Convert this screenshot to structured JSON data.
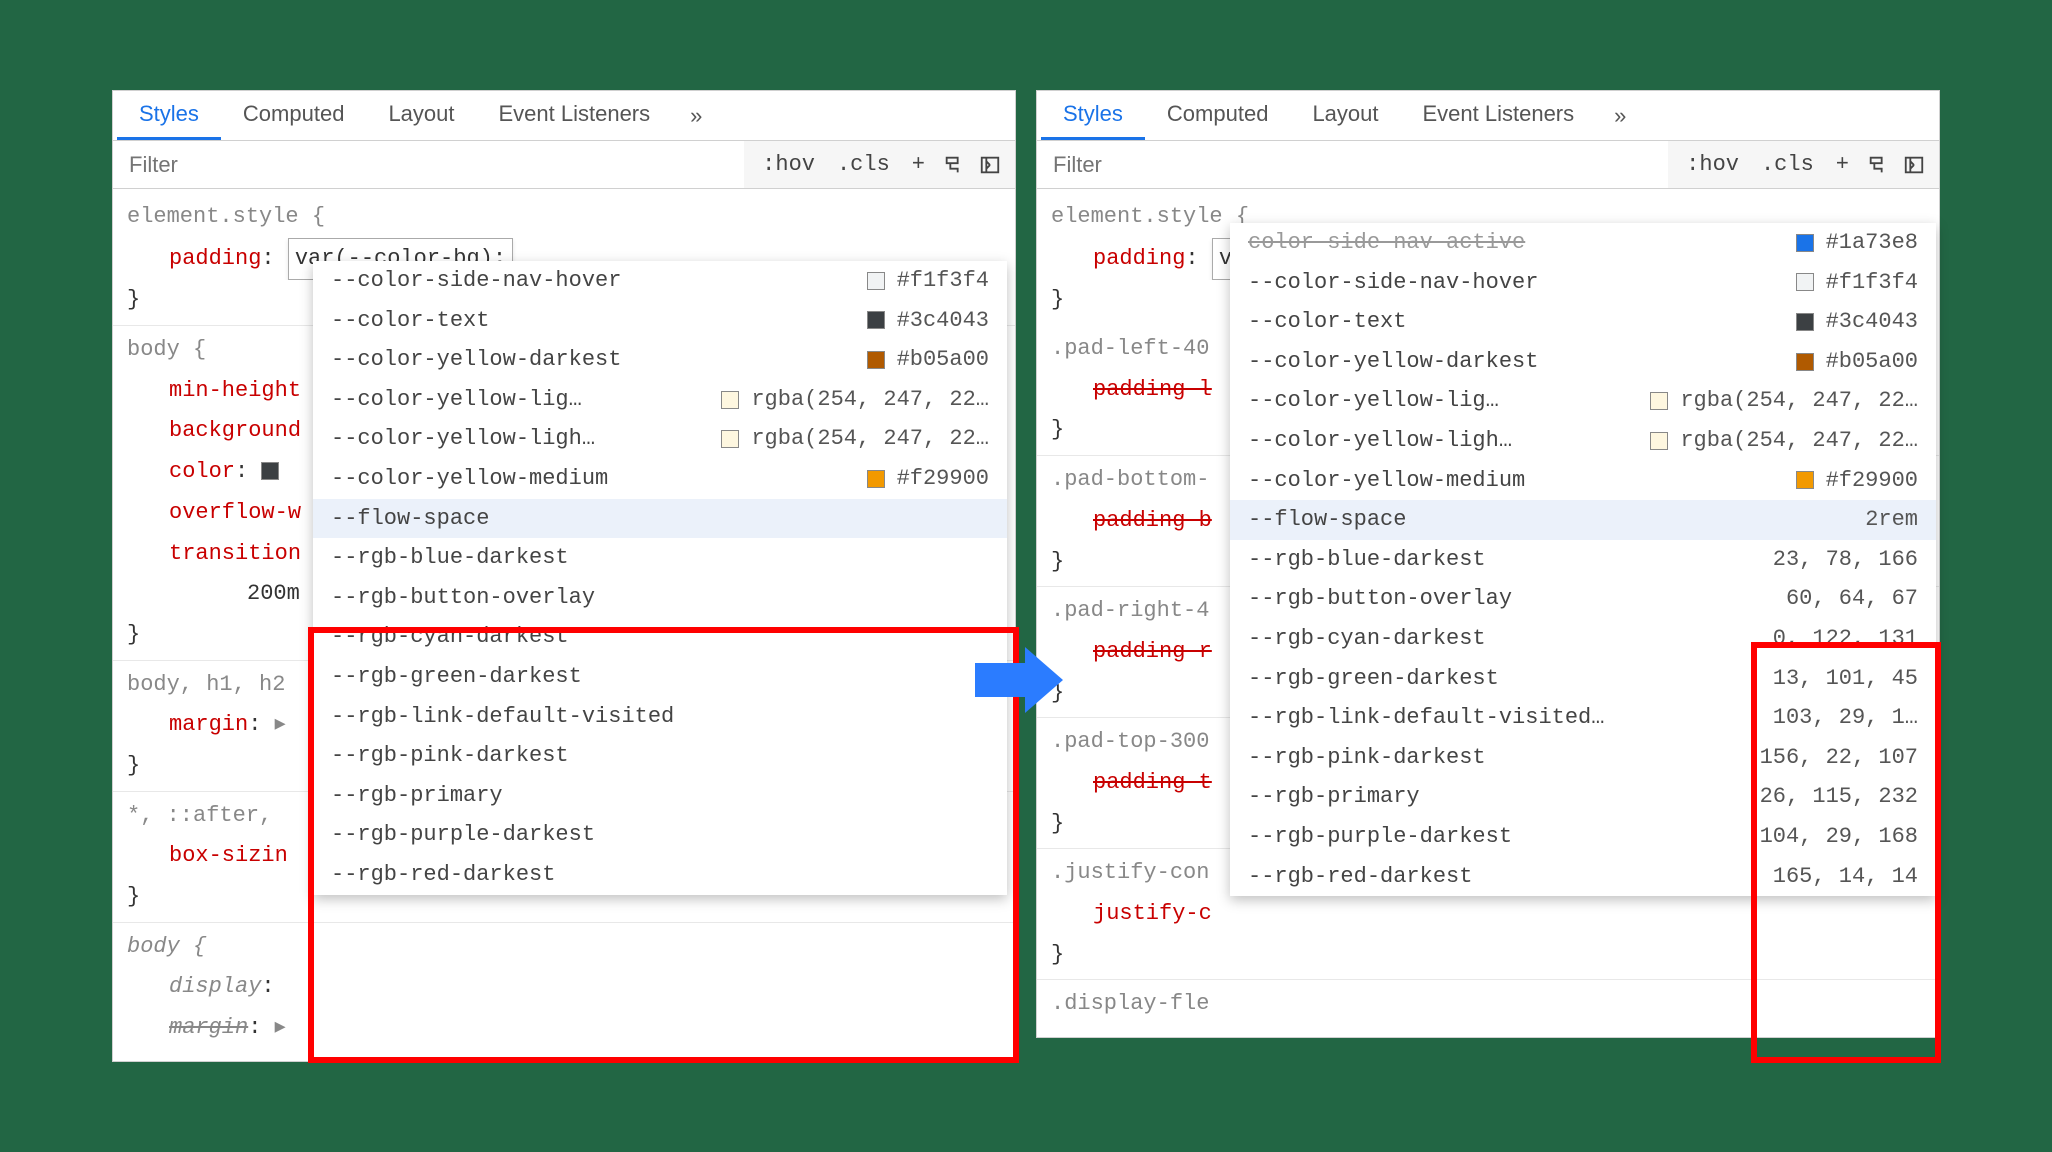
{
  "tabs": [
    "Styles",
    "Computed",
    "Layout",
    "Event Listeners"
  ],
  "active_tab": 0,
  "filter_placeholder": "Filter",
  "toolbar": {
    "hov": ":hov",
    "cls": ".cls",
    "plus": "+"
  },
  "element_style_text": "element.style {",
  "padding_prop": "padding",
  "padding_val": "var(--color-bg);",
  "close_brace": "}",
  "left_rules": [
    {
      "selector": "body {",
      "props": [
        {
          "name": "min-height",
          "partial": true
        },
        {
          "name": "background",
          "partial": true
        },
        {
          "name": "color",
          "val_prefix": "■",
          "partial": true
        },
        {
          "name": "overflow-w",
          "partial": true
        },
        {
          "name": "transition",
          "partial": true
        },
        {
          "indent": "200m",
          "partial": true
        }
      ]
    },
    {
      "selector": "body, h1, h2",
      "props": [
        {
          "name": "margin",
          "val_prefix": "▸"
        }
      ]
    },
    {
      "selector": "*, ::after,",
      "props": [
        {
          "name": "box-sizin",
          "partial": true
        }
      ]
    },
    {
      "selector_italic": "body {",
      "props": [
        {
          "name": "display",
          "italic": true
        },
        {
          "name": "margin",
          "val_prefix": "▸",
          "italic": true,
          "strike": true
        }
      ]
    }
  ],
  "right_rules": [
    {
      "selector": ".pad-left-40",
      "props": [
        {
          "name": "padding-l",
          "strike": true
        }
      ]
    },
    {
      "selector": ".pad-bottom-",
      "props": [
        {
          "name": "padding-b",
          "strike": true
        }
      ]
    },
    {
      "selector": ".pad-right-4",
      "props": [
        {
          "name": "padding-r",
          "strike": true
        }
      ]
    },
    {
      "selector": ".pad-top-300",
      "props": [
        {
          "name": "padding-t",
          "strike": true
        }
      ]
    },
    {
      "selector": ".justify-con",
      "props": [
        {
          "name": "justify-c"
        }
      ]
    },
    {
      "selector": ".display-fle"
    }
  ],
  "autocomplete_top": [
    {
      "name": "--color-side-nav-hover",
      "swatch": "#f1f3f4",
      "val": "#f1f3f4"
    },
    {
      "name": "--color-text",
      "swatch": "#3c4043",
      "val": "#3c4043"
    },
    {
      "name": "--color-yellow-darkest",
      "swatch": "#b05a00",
      "val": "#b05a00"
    },
    {
      "name": "--color-yellow-lig…",
      "swatch": "#fef7e0",
      "val": "rgba(254, 247, 22…"
    },
    {
      "name": "--color-yellow-ligh…",
      "swatch": "#fef7e0",
      "val": "rgba(254, 247, 22…"
    },
    {
      "name": "--color-yellow-medium",
      "swatch": "#f29900",
      "val": "#f29900"
    }
  ],
  "autocomplete_bottom_left": [
    {
      "name": "--flow-space",
      "sel": true
    },
    {
      "name": "--rgb-blue-darkest"
    },
    {
      "name": "--rgb-button-overlay"
    },
    {
      "name": "--rgb-cyan-darkest"
    },
    {
      "name": "--rgb-green-darkest"
    },
    {
      "name": "--rgb-link-default-visited"
    },
    {
      "name": "--rgb-pink-darkest"
    },
    {
      "name": "--rgb-primary"
    },
    {
      "name": "--rgb-purple-darkest"
    },
    {
      "name": "--rgb-red-darkest"
    }
  ],
  "autocomplete_bottom_right": [
    {
      "name": "--flow-space",
      "val": "2rem",
      "sel": true
    },
    {
      "name": "--rgb-blue-darkest",
      "val": "23, 78, 166"
    },
    {
      "name": "--rgb-button-overlay",
      "val": "60, 64, 67"
    },
    {
      "name": "--rgb-cyan-darkest",
      "val": "0, 122, 131"
    },
    {
      "name": "--rgb-green-darkest",
      "val": "13, 101, 45"
    },
    {
      "name": "--rgb-link-default-visited…",
      "val": "103, 29, 1…"
    },
    {
      "name": "--rgb-pink-darkest",
      "val": "156, 22, 107"
    },
    {
      "name": "--rgb-primary",
      "val": "26, 115, 232"
    },
    {
      "name": "--rgb-purple-darkest",
      "val": "104, 29, 168"
    },
    {
      "name": "--rgb-red-darkest",
      "val": "165, 14, 14"
    }
  ],
  "right_extra_top": {
    "name": "color side nav active",
    "val": "#1a73e8",
    "swatch": "#1a73e8"
  }
}
